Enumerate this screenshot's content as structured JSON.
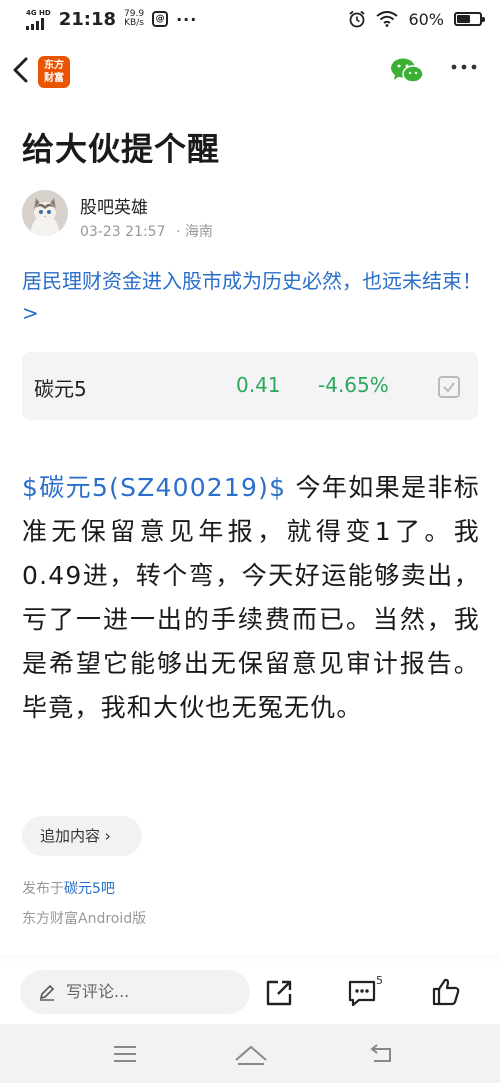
{
  "status_bar": {
    "network": "4G HD",
    "time": "21:18",
    "speed_value": "79.9",
    "speed_unit": "KB/s",
    "app_badge": "@",
    "more": "···",
    "battery_text": "60%",
    "battery_level": 0.6
  },
  "nav": {
    "logo_line1": "东方",
    "logo_line2": "财富",
    "logo_color": "#ea5504",
    "icons": [
      "back-icon",
      "wechat-share-icon",
      "more-icon"
    ]
  },
  "post": {
    "title": "给大伙提个醒",
    "author_name": "股吧英雄",
    "datetime": "03-23 21:57",
    "location": "· 海南",
    "headline_link": "居民理财资金进入股市成为历史必然，也远未结束！ >",
    "body_tag": "$碳元5(SZ400219)$",
    "body_text": " 今年如果是非标准无保留意见年报，就得变1了。我0.49进，转个弯，今天好运能够卖出，亏了一进一出的手续费而已。当然，我是希望它能够出无保留意见审计报告。毕竟，我和大伙也无冤无仇。",
    "add_content_label": "追加内容 ›",
    "published_prefix": "发布于",
    "published_bar": "碳元5吧",
    "client": "东方财富Android版"
  },
  "stock": {
    "name": "碳元5",
    "price": "0.41",
    "change": "-4.65%",
    "color_down": "#2aa95e"
  },
  "bottom_bar": {
    "comment_placeholder": "写评论...",
    "comment_count": "5"
  },
  "colors": {
    "link": "#2a6fc9",
    "muted": "#999999"
  }
}
